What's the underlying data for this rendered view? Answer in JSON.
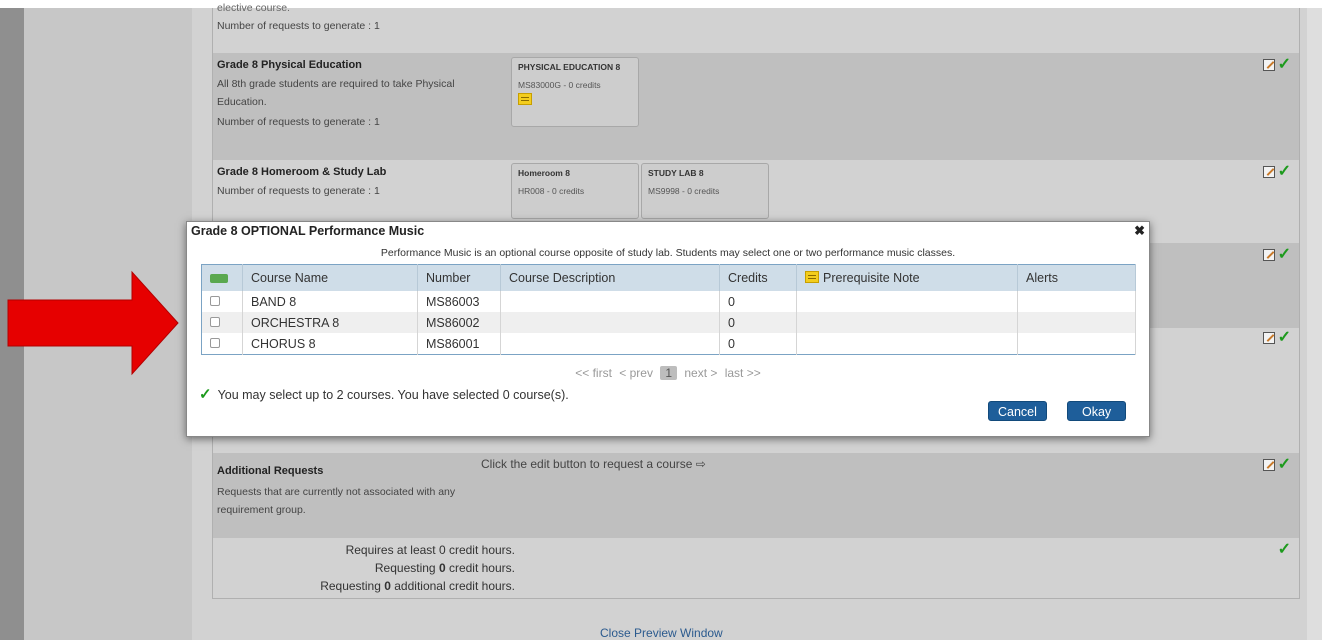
{
  "preview": {
    "partial_text": "elective course.",
    "row1_requests": "Number of requests to generate : 1",
    "groups": [
      {
        "title": "Grade 8 Physical Education",
        "description": "All 8th grade students are required to take Physical Education.",
        "requests": "Number of requests to generate : 1",
        "courses": [
          {
            "name": "PHYSICAL EDUCATION 8",
            "credits": "MS83000G - 0 credits"
          }
        ]
      },
      {
        "title": "Grade 8 Homeroom & Study Lab",
        "requests": "Number of requests to generate : 1",
        "courses": [
          {
            "name": "Homeroom 8",
            "credits": "HR008 - 0 credits"
          },
          {
            "name": "STUDY LAB 8",
            "credits": "MS9998 - 0 credits"
          }
        ]
      }
    ],
    "additional": {
      "title": "Additional Requests",
      "description": "Requests that are currently not associated with any requirement group.",
      "hint": "Click the edit button to request a course ⇨"
    },
    "summary": {
      "requires": "Requires at least 0 credit hours.",
      "req_pre": "Requesting ",
      "req_num": "0",
      "req_post": " credit hours.",
      "add_pre": "Requesting ",
      "add_num": "0",
      "add_post": " additional credit hours."
    },
    "close_link": "Close Preview Window"
  },
  "dialog": {
    "title": "Grade 8 OPTIONAL Performance Music",
    "close_glyph": "✖",
    "subtitle": "Performance Music is an optional course opposite of study lab. Students may select one or two performance music classes.",
    "columns": [
      "Course Name",
      "Number",
      "Course Description",
      "Credits",
      "Prerequisite Note",
      "Alerts"
    ],
    "rows": [
      {
        "name": "BAND 8",
        "number": "MS86003",
        "description": "",
        "credits": "0",
        "note": "",
        "alerts": ""
      },
      {
        "name": "ORCHESTRA 8",
        "number": "MS86002",
        "description": "",
        "credits": "0",
        "note": "",
        "alerts": ""
      },
      {
        "name": "CHORUS 8",
        "number": "MS86001",
        "description": "",
        "credits": "0",
        "note": "",
        "alerts": ""
      }
    ],
    "pager": {
      "first": "<< first",
      "prev": "< prev",
      "current": "1",
      "next": "next >",
      "last": "last >>"
    },
    "selection_info": "You may select up to 2 courses.  You have selected 0 course(s).",
    "cancel_label": "Cancel",
    "okay_label": "Okay"
  },
  "colors": {
    "accent_button": "#1e5e9a",
    "check_green": "#1d9a1d",
    "arrow_red": "#e60000",
    "note_yellow": "#f3cd1d"
  },
  "icons": [
    "edit-icon",
    "check-icon",
    "note-icon",
    "close-icon",
    "select-all-icon",
    "red-arrow-icon",
    "right-arrow-icon"
  ]
}
